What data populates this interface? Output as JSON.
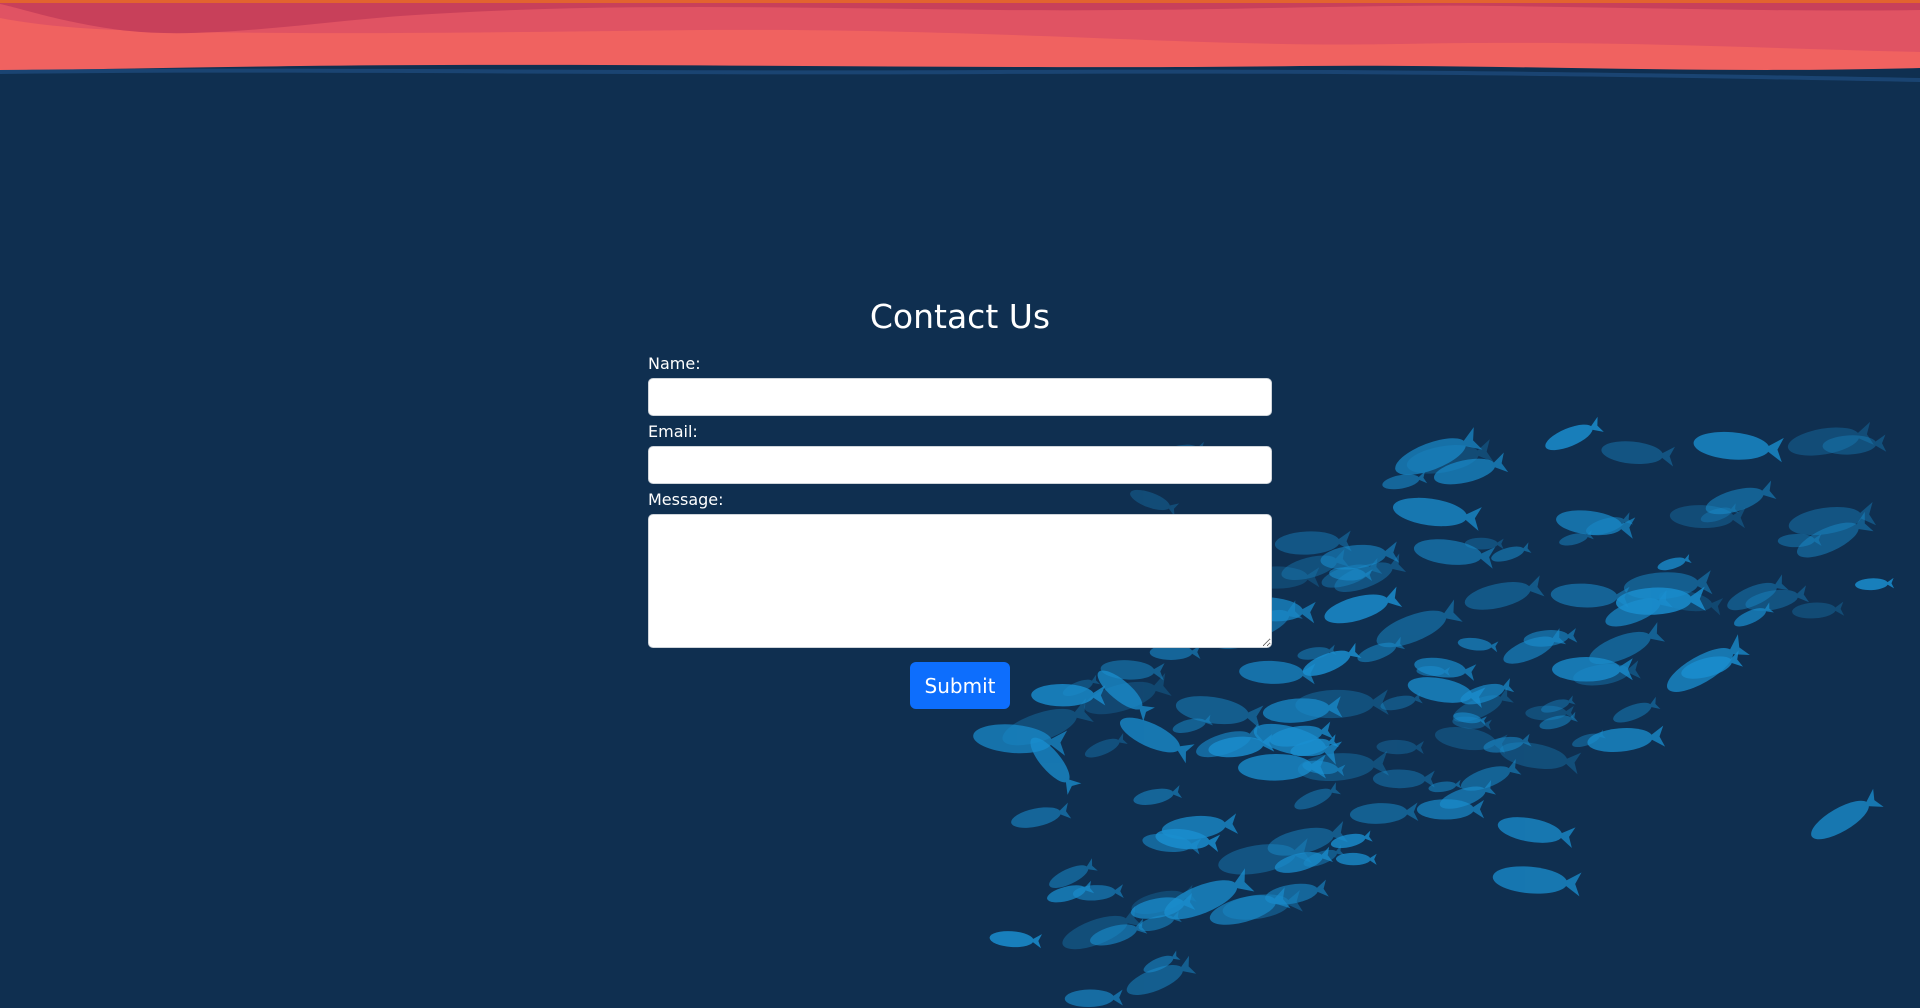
{
  "page": {
    "background_color": "#0f2f50",
    "accent_top_wave": [
      "#c8405a",
      "#e05363",
      "#f06260"
    ],
    "fish_color": "#1a8fd0"
  },
  "form": {
    "title": "Contact Us",
    "name_label": "Name:",
    "name_value": "",
    "email_label": "Email:",
    "email_value": "",
    "message_label": "Message:",
    "message_value": "",
    "submit_label": "Submit",
    "submit_color": "#0d6efd"
  }
}
